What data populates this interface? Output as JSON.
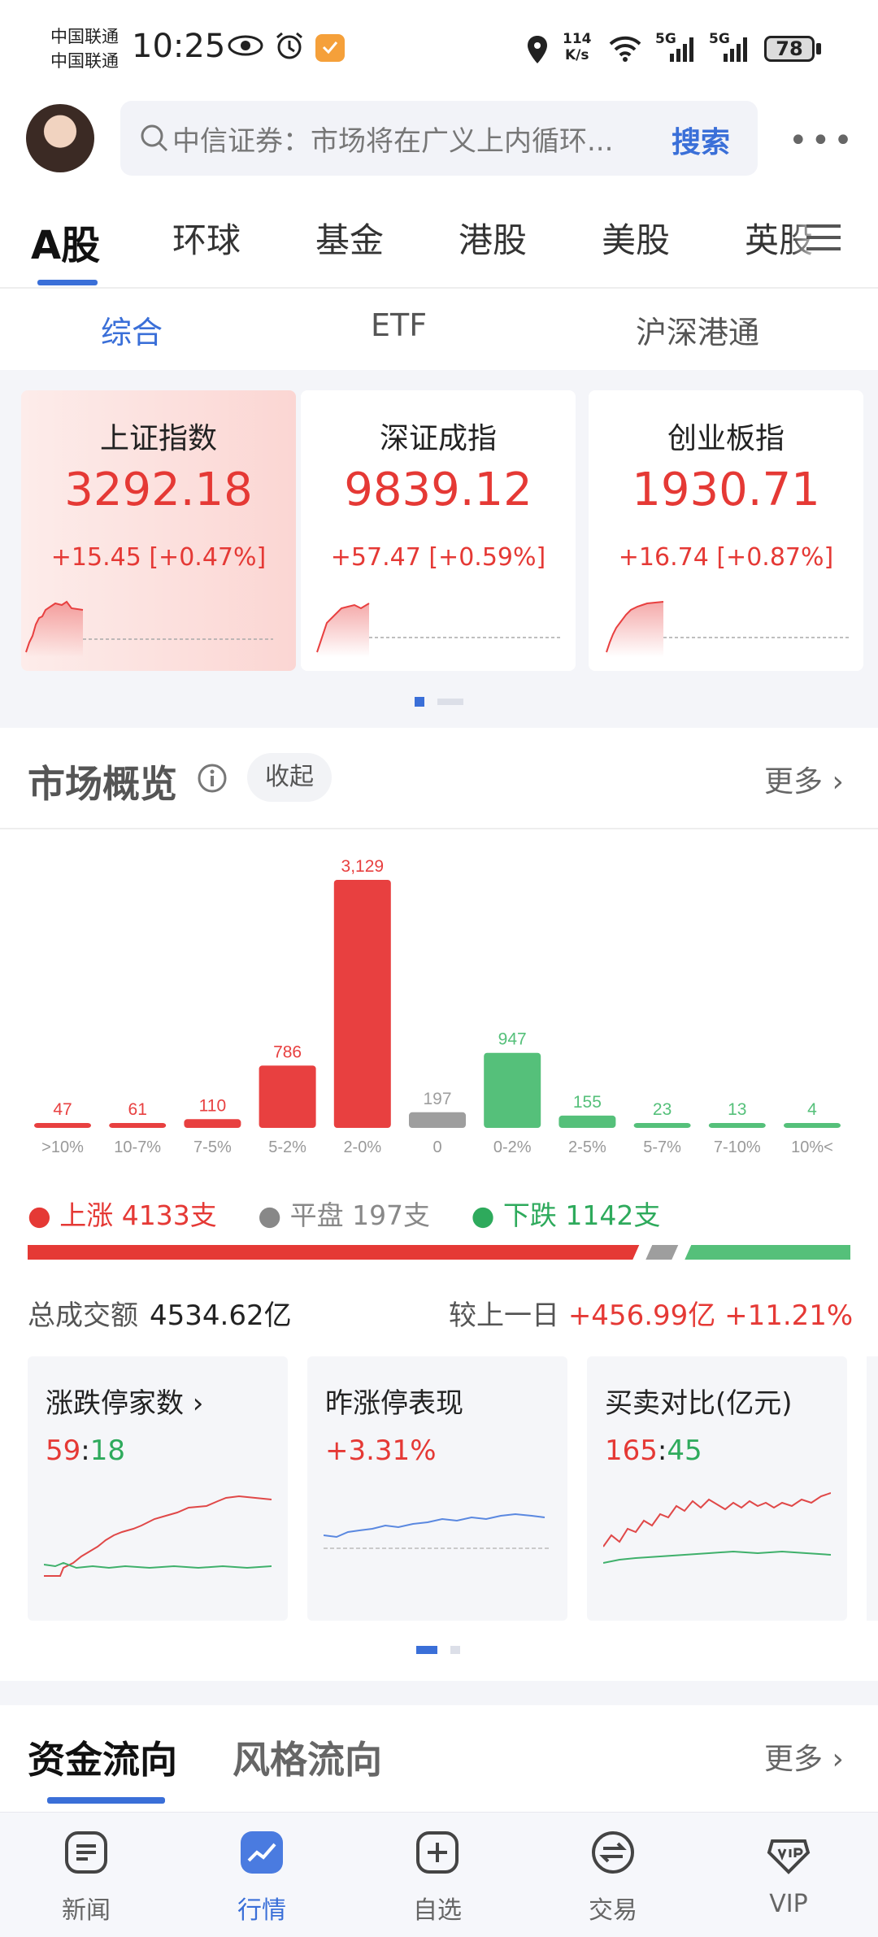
{
  "status_bar": {
    "carrier1": "中国联通",
    "carrier2": "中国联通",
    "time": "10:25",
    "net_speed_value": "114",
    "net_speed_unit": "K/s",
    "signal1": "5G",
    "signal2": "5G",
    "battery": "78"
  },
  "search": {
    "placeholder": "中信证券：市场将在广义上内循环...",
    "button": "搜索"
  },
  "more_menu": "•••",
  "tabs": [
    "A股",
    "环球",
    "基金",
    "港股",
    "美股",
    "英股"
  ],
  "sub_tabs": [
    "综合",
    "ETF",
    "沪深港通"
  ],
  "index_cards": [
    {
      "name": "上证指数",
      "value": "3292.18",
      "change": "+15.45 [+0.47%]"
    },
    {
      "name": "深证成指",
      "value": "9839.12",
      "change": "+57.47 [+0.59%]"
    },
    {
      "name": "创业板指",
      "value": "1930.71",
      "change": "+16.74 [+0.87%]"
    }
  ],
  "market": {
    "title": "市场概览",
    "collapse": "收起",
    "more": "更多",
    "legend": {
      "up": "上涨 4133支",
      "flat": "平盘 197支",
      "down": "下跌 1142支"
    },
    "turnover_label": "总成交额",
    "turnover_value": "4534.62亿",
    "compare_label": "较上一日",
    "compare_value": "+456.99亿 +11.21%"
  },
  "chart_data": {
    "type": "bar",
    "categories": [
      ">10%",
      "10-7%",
      "7-5%",
      "5-2%",
      "2-0%",
      "0",
      "0-2%",
      "2-5%",
      "5-7%",
      "7-10%",
      "10%<"
    ],
    "values": [
      47,
      61,
      110,
      786,
      3129,
      197,
      947,
      155,
      23,
      13,
      4
    ],
    "value_labels": [
      "47",
      "61",
      "110",
      "786",
      "3,129",
      "197",
      "947",
      "155",
      "23",
      "13",
      "4"
    ],
    "colors": [
      "#e84040",
      "#e84040",
      "#e84040",
      "#e84040",
      "#e84040",
      "#9e9e9e",
      "#55c07a",
      "#55c07a",
      "#55c07a",
      "#55c07a",
      "#55c07a"
    ],
    "ratio": {
      "up": 4133,
      "flat": 197,
      "down": 1142
    },
    "title": "",
    "xlabel": "",
    "ylabel": ""
  },
  "mini_cards": [
    {
      "title": "涨跌停家数",
      "value_a": "59",
      "value_b": "18"
    },
    {
      "title": "昨涨停表现",
      "value": "+3.31%"
    },
    {
      "title": "买卖对比(亿元)",
      "value_a": "165",
      "value_b": "45"
    }
  ],
  "flow": {
    "tab1": "资金流向",
    "tab2": "风格流向",
    "more": "更多"
  },
  "nav": [
    "新闻",
    "行情",
    "自选",
    "交易",
    "VIP"
  ],
  "colors": {
    "accent": "#3a6fd8",
    "up": "#e53935",
    "down": "#2eaa5c"
  }
}
